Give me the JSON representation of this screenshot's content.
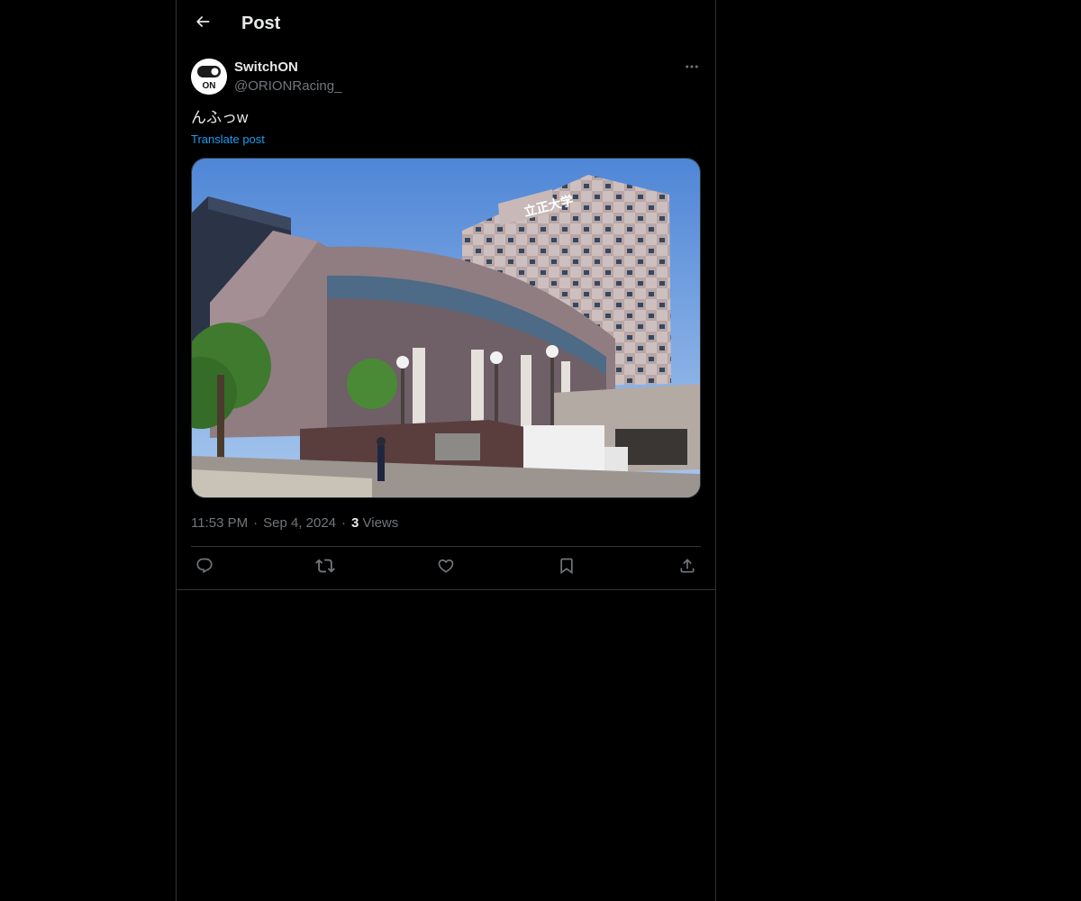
{
  "header": {
    "title": "Post",
    "back_icon": "arrow-left-icon"
  },
  "post": {
    "author": {
      "name": "SwitchON",
      "handle": "@ORIONRacing_",
      "avatar_text": "ON"
    },
    "more_icon": "more-horizontal-icon",
    "text": "んふっw",
    "translate_label": "Translate post",
    "media": {
      "type": "photo",
      "subject": "university-building",
      "sign_text": "立正大学"
    },
    "time": "11:53 PM",
    "date": "Sep 4, 2024",
    "views_count": "3",
    "views_label": "Views",
    "separator": "·",
    "actions": [
      {
        "name": "reply",
        "icon": "reply-icon"
      },
      {
        "name": "repost",
        "icon": "repost-icon"
      },
      {
        "name": "like",
        "icon": "heart-icon"
      },
      {
        "name": "bookmark",
        "icon": "bookmark-icon"
      },
      {
        "name": "share",
        "icon": "share-icon"
      }
    ]
  },
  "colors": {
    "background": "#000000",
    "border": "#2f3336",
    "text_primary": "#e7e9ea",
    "text_secondary": "#71767b",
    "link": "#1d9bf0"
  }
}
